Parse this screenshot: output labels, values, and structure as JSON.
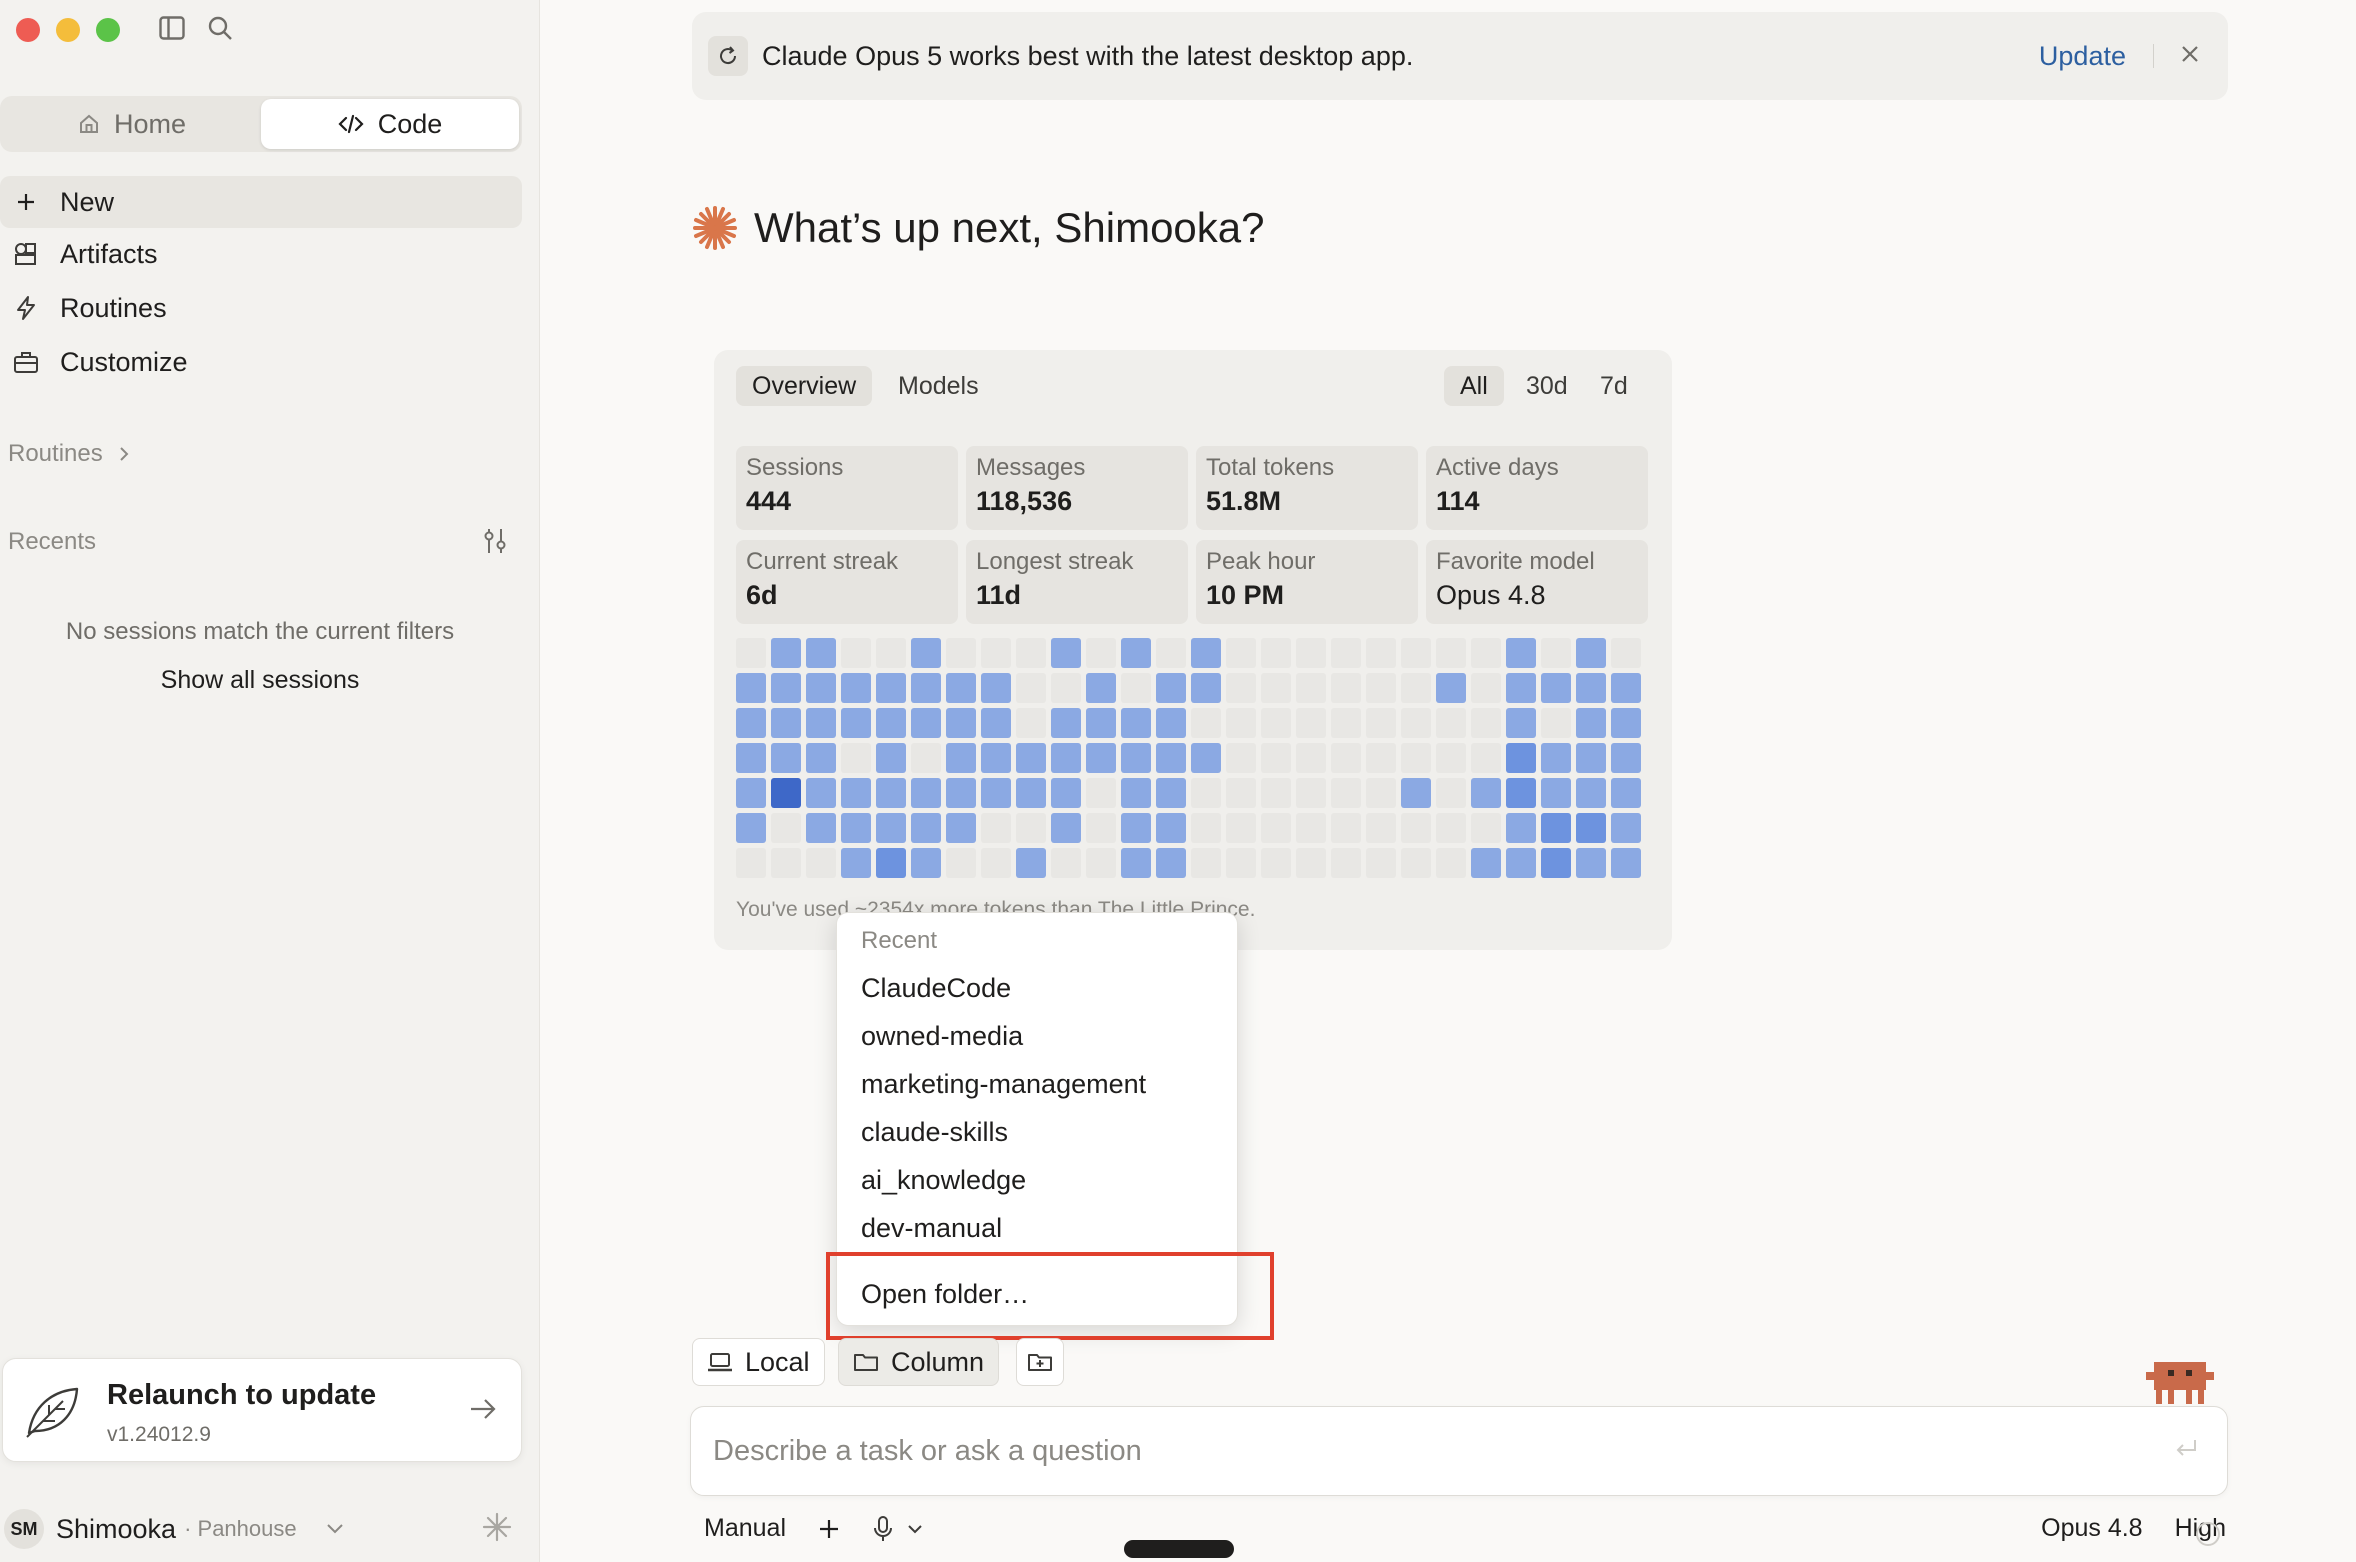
{
  "sidebar": {
    "tabs": [
      {
        "label": "Home",
        "icon": "home-icon"
      },
      {
        "label": "Code",
        "icon": "code-icon",
        "active": true
      }
    ],
    "nav": [
      {
        "label": "New",
        "icon": "plus-icon"
      },
      {
        "label": "Artifacts",
        "icon": "artifacts-icon"
      },
      {
        "label": "Routines",
        "icon": "bolt-icon"
      },
      {
        "label": "Customize",
        "icon": "briefcase-icon"
      }
    ],
    "routines_label": "Routines",
    "recents_label": "Recents",
    "empty_message": "No sessions match the current filters",
    "show_all": "Show all sessions",
    "relaunch": {
      "title": "Relaunch to update",
      "version": "v1.24012.9"
    },
    "user": {
      "initials": "SM",
      "name": "Shimooka",
      "org": "· Panhouse"
    }
  },
  "banner": {
    "message": "Claude Opus 5 works best with the latest desktop app.",
    "update_label": "Update"
  },
  "greeting": "What’s up next, Shimooka?",
  "stats": {
    "tabs": [
      "Overview",
      "Models"
    ],
    "ranges": [
      "All",
      "30d",
      "7d"
    ],
    "cards": [
      {
        "label": "Sessions",
        "value": "444"
      },
      {
        "label": "Messages",
        "value": "118,536"
      },
      {
        "label": "Total tokens",
        "value": "51.8M"
      },
      {
        "label": "Active days",
        "value": "114"
      },
      {
        "label": "Current streak",
        "value": "6d"
      },
      {
        "label": "Longest streak",
        "value": "11d"
      },
      {
        "label": "Peak hour",
        "value": "10 PM"
      },
      {
        "label": "Favorite model",
        "value": "Opus 4.8"
      }
    ],
    "heatmap": [
      [
        0,
        1,
        1,
        0,
        0,
        1,
        0,
        0,
        0,
        1,
        0,
        1,
        0,
        1,
        0,
        0,
        0,
        0,
        0,
        0,
        0,
        0,
        1,
        0,
        1,
        0
      ],
      [
        1,
        1,
        1,
        1,
        1,
        1,
        1,
        1,
        0,
        0,
        1,
        0,
        1,
        1,
        0,
        0,
        0,
        0,
        0,
        0,
        1,
        0,
        1,
        1,
        1,
        1
      ],
      [
        1,
        1,
        1,
        1,
        1,
        1,
        1,
        1,
        0,
        1,
        1,
        1,
        1,
        0,
        0,
        0,
        0,
        0,
        0,
        0,
        0,
        0,
        1,
        0,
        1,
        1
      ],
      [
        1,
        1,
        1,
        0,
        1,
        0,
        1,
        1,
        1,
        1,
        1,
        1,
        1,
        1,
        0,
        0,
        0,
        0,
        0,
        0,
        0,
        0,
        2,
        1,
        1,
        1
      ],
      [
        1,
        3,
        1,
        1,
        1,
        1,
        1,
        1,
        1,
        1,
        0,
        1,
        1,
        0,
        0,
        0,
        0,
        0,
        0,
        1,
        0,
        1,
        2,
        1,
        1,
        1
      ],
      [
        1,
        0,
        1,
        1,
        1,
        1,
        1,
        0,
        0,
        1,
        0,
        1,
        1,
        0,
        0,
        0,
        0,
        0,
        0,
        0,
        0,
        0,
        1,
        2,
        2,
        1
      ],
      [
        0,
        0,
        0,
        1,
        2,
        1,
        0,
        0,
        1,
        0,
        0,
        1,
        1,
        0,
        0,
        0,
        0,
        0,
        0,
        0,
        0,
        1,
        1,
        2,
        1,
        1
      ]
    ],
    "note": "You've used ~2354x more tokens than The Little Prince."
  },
  "dropdown": {
    "header": "Recent",
    "items": [
      "ClaudeCode",
      "owned-media",
      "marketing-management",
      "claude-skills",
      "ai_knowledge",
      "dev-manual"
    ],
    "open_folder": "Open folder…"
  },
  "composer": {
    "chips": [
      "Local",
      "Column"
    ],
    "placeholder": "Describe a task or ask a question",
    "mode": "Manual",
    "model": "Opus 4.8",
    "effort": "High"
  },
  "colors": {
    "heat_empty": "#e8e7e4",
    "heat_1": "#8ba9e3",
    "heat_2": "#6d93df",
    "heat_3": "#3e68c8",
    "accent_orange": "#d9764a",
    "link_blue": "#2d5fa0",
    "highlight_red": "#e0402d"
  }
}
